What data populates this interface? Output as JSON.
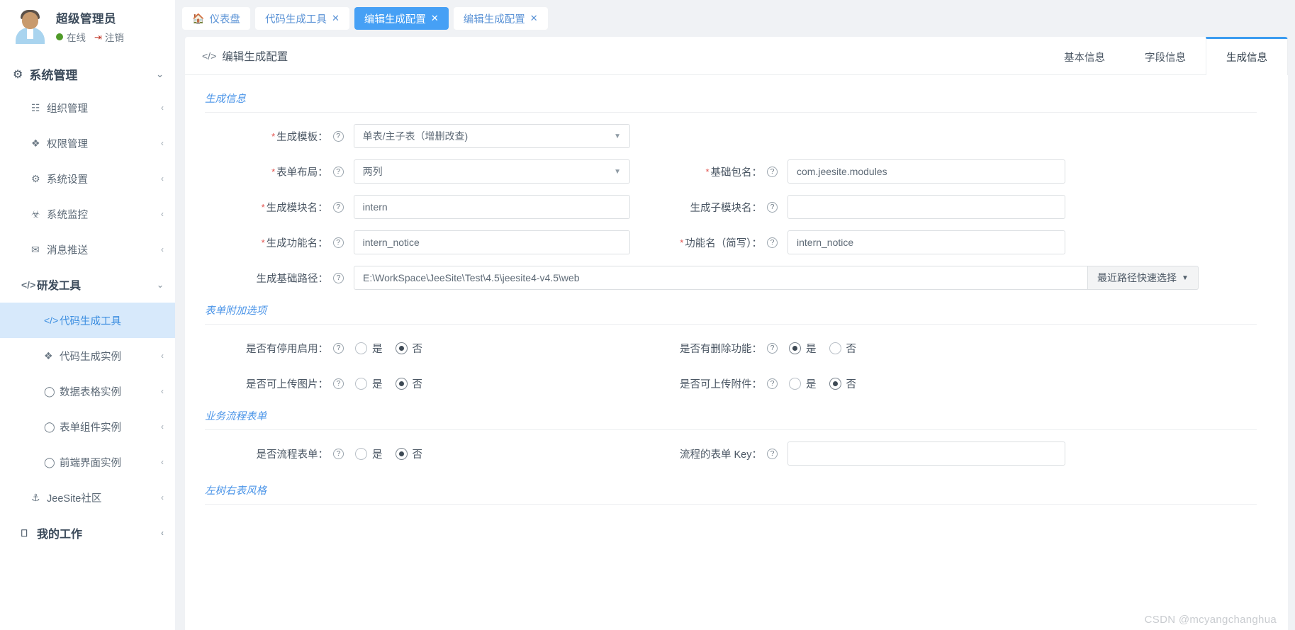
{
  "sidebar": {
    "user": {
      "name": "超级管理员",
      "status": "在线",
      "logout": "注销",
      "avatar_icon": "user-avatar"
    },
    "group_title": "系统管理",
    "group_icon": "gear-icon",
    "items": [
      {
        "label": "组织管理",
        "icon": "grid-icon",
        "caret": "‹",
        "active": false
      },
      {
        "label": "权限管理",
        "icon": "box-icon",
        "caret": "‹",
        "active": false
      },
      {
        "label": "系统设置",
        "icon": "gear-icon",
        "caret": "‹",
        "active": false
      },
      {
        "label": "系统监控",
        "icon": "ghost-icon",
        "caret": "‹",
        "active": false
      },
      {
        "label": "消息推送",
        "icon": "envelope-icon",
        "caret": "‹",
        "active": false
      }
    ],
    "dev_group": {
      "label": "研发工具",
      "icon": "code-icon",
      "caret": "⌄"
    },
    "dev_items": [
      {
        "label": "代码生成工具",
        "icon": "code-icon",
        "caret": "",
        "active": true
      },
      {
        "label": "代码生成实例",
        "icon": "box-icon",
        "caret": "‹",
        "active": false
      },
      {
        "label": "数据表格实例",
        "icon": "circle-icon",
        "caret": "‹",
        "active": false
      },
      {
        "label": "表单组件实例",
        "icon": "circle-icon",
        "caret": "‹",
        "active": false
      },
      {
        "label": "前端界面实例",
        "icon": "circle-icon",
        "caret": "‹",
        "active": false
      }
    ],
    "community": {
      "label": "JeeSite社区",
      "icon": "signpost-icon",
      "caret": "‹"
    },
    "my_work": {
      "label": "我的工作",
      "icon": "monitor-icon",
      "caret": "‹"
    }
  },
  "tabbar": [
    {
      "label": "仪表盘",
      "icon": "home-icon",
      "closable": false,
      "active": false
    },
    {
      "label": "代码生成工具",
      "icon": "",
      "closable": true,
      "active": false
    },
    {
      "label": "编辑生成配置",
      "icon": "",
      "closable": true,
      "active": true
    },
    {
      "label": "编辑生成配置",
      "icon": "",
      "closable": true,
      "active": false
    }
  ],
  "panel": {
    "title": "编辑生成配置",
    "title_icon": "code-icon",
    "tabs": [
      {
        "label": "基本信息",
        "active": false
      },
      {
        "label": "字段信息",
        "active": false
      },
      {
        "label": "生成信息",
        "active": true
      }
    ]
  },
  "sections": {
    "generate_info": "生成信息",
    "form_extra": "表单附加选项",
    "workflow_form": "业务流程表单",
    "tree_table_style": "左树右表风格"
  },
  "fields": {
    "template": {
      "label": "生成模板：",
      "required": true,
      "value": "单表/主子表（增删改查)",
      "help": "?"
    },
    "layout": {
      "label": "表单布局：",
      "required": true,
      "value": "两列",
      "help": "?"
    },
    "base_package": {
      "label": "基础包名：",
      "required": true,
      "value": "com.jeesite.modules",
      "help": "?"
    },
    "module_name": {
      "label": "生成模块名：",
      "required": true,
      "value": "intern",
      "help": "?"
    },
    "sub_module_name": {
      "label": "生成子模块名：",
      "required": false,
      "value": "",
      "help": "?"
    },
    "function_name": {
      "label": "生成功能名：",
      "required": true,
      "value": "intern_notice",
      "help": "?"
    },
    "function_short": {
      "label": "功能名（简写）：",
      "required": true,
      "value": "intern_notice",
      "help": "?"
    },
    "base_path": {
      "label": "生成基础路径：",
      "required": false,
      "value": "E:\\WorkSpace\\JeeSite\\Test\\4.5\\jeesite4-v4.5\\web",
      "help": "?"
    },
    "recent_path_button": "最近路径快速选择",
    "flow_form_key": {
      "label": "流程的表单 Key：",
      "required": false,
      "value": "",
      "help": "?"
    }
  },
  "radio_rows": [
    {
      "left": {
        "label": "是否有停用启用：",
        "help": "?",
        "options": [
          "是",
          "否"
        ],
        "selected": "否"
      },
      "right": {
        "label": "是否有删除功能：",
        "help": "?",
        "options": [
          "是",
          "否"
        ],
        "selected": "是"
      }
    },
    {
      "left": {
        "label": "是否可上传图片：",
        "help": "?",
        "options": [
          "是",
          "否"
        ],
        "selected": "否"
      },
      "right": {
        "label": "是否可上传附件：",
        "help": "?",
        "options": [
          "是",
          "否"
        ],
        "selected": "否"
      }
    }
  ],
  "workflow_row": {
    "left": {
      "label": "是否流程表单：",
      "help": "?",
      "options": [
        "是",
        "否"
      ],
      "selected": "否"
    }
  },
  "watermark": "CSDN @mcyangchanghua",
  "colors": {
    "accent_blue": "#46a0f5",
    "section_blue": "#4a94e8",
    "active_menu_bg": "#d7e9fb",
    "required_red": "#e2534f",
    "online_green": "#4f9a28"
  }
}
